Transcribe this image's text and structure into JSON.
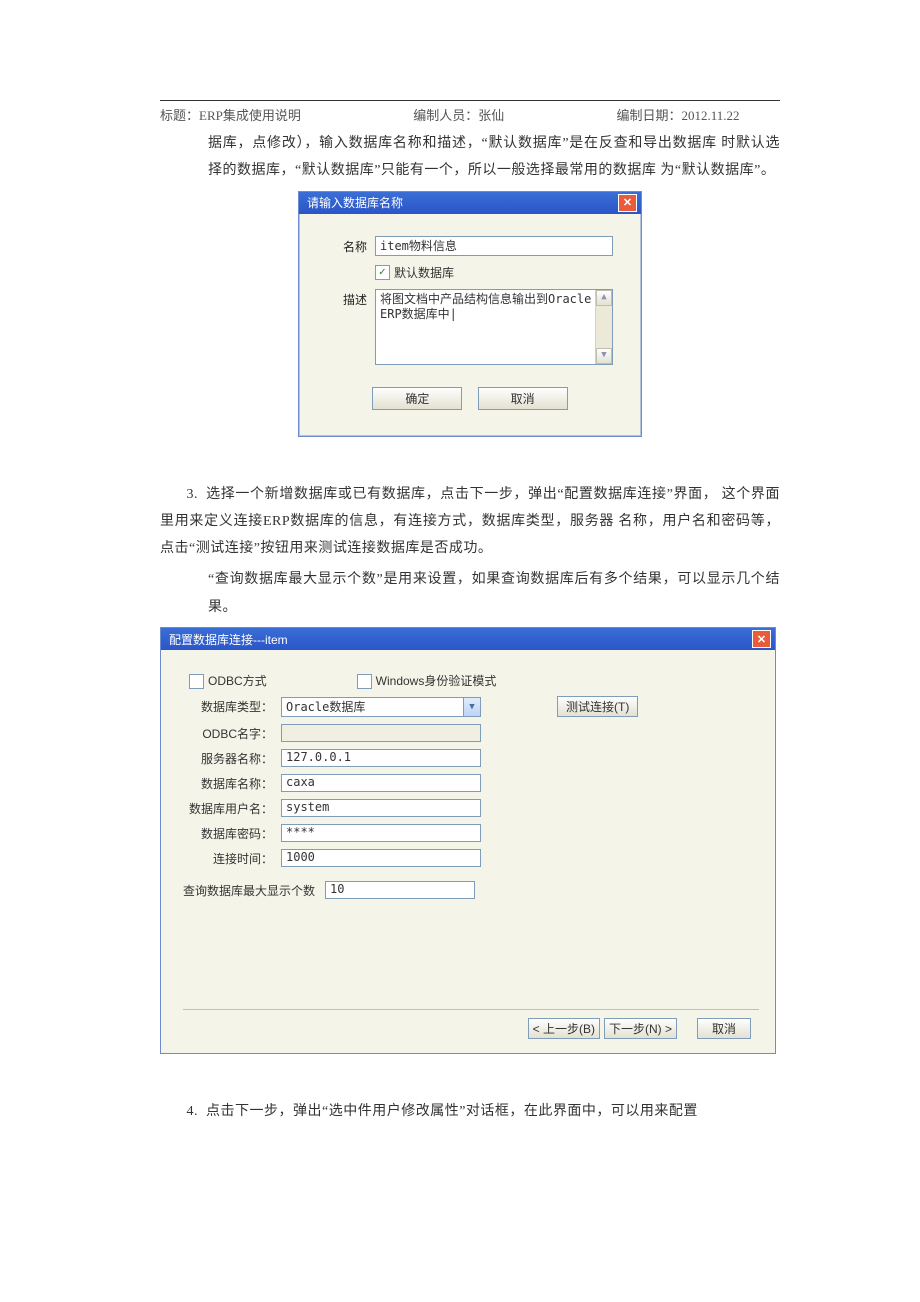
{
  "header": {
    "title": "标题：ERP集成使用说明",
    "author": "编制人员：张仙",
    "date": "编制日期：2012.11.22"
  },
  "para1": "据库，点修改），输入数据库名称和描述，“默认数据库”是在反查和导出数据库 时默认选择的数据库，“默认数据库”只能有一个，所以一般选择最常用的数据库 为“默认数据库”。",
  "dialog1": {
    "title": "请输入数据库名称",
    "label_name": "名称",
    "name_value": "item物料信息",
    "chk_default_label": "默认数据库",
    "chk_checked_glyph": "✓",
    "label_desc": "描述",
    "desc_value": "将图文档中产品结构信息输出到Oracle ERP数据库中|",
    "btn_ok": "确定",
    "btn_cancel": "取消"
  },
  "item3_num": "3.",
  "item3_text": "选择一个新增数据库或已有数据库，点击下一步，弹出“配置数据库连接”界面，  这个界面里用来定义连接ERP数据库的信息，有连接方式，数据库类型，服务器  名称，用户名和密码等，点击“测试连接”按钮用来测试连接数据库是否成功。",
  "item3_text2": "“查询数据库最大显示个数”是用来设置，如果查询数据库后有多个结果，可以显示几个结果。",
  "dialog2": {
    "title": "配置数据库连接---item",
    "odbc_chk": "ODBC方式",
    "win_auth_chk": "Windows身份验证模式",
    "label_dbtype": "数据库类型：",
    "dbtype_value": "Oracle数据库",
    "btn_test": "测试连接(T)",
    "label_odbcname": "ODBC名字：",
    "odbcname_value": "",
    "label_server": "服务器名称：",
    "server_value": "127.0.0.1",
    "label_dbname": "数据库名称：",
    "dbname_value": "caxa",
    "label_dbuser": "数据库用户名：",
    "dbuser_value": "system",
    "label_dbpwd": "数据库密码：",
    "dbpwd_value": "****",
    "label_conntime": "连接时间：",
    "conntime_value": "1000",
    "label_maxrows": "查询数据库最大显示个数",
    "maxrows_value": "10",
    "btn_prev": "< 上一步(B)",
    "btn_next": "下一步(N) >",
    "btn_cancel": "取消"
  },
  "item4_num": "4.",
  "item4_text": "点击下一步，弹出“选中件用户修改属性”对话框，在此界面中，可以用来配置"
}
